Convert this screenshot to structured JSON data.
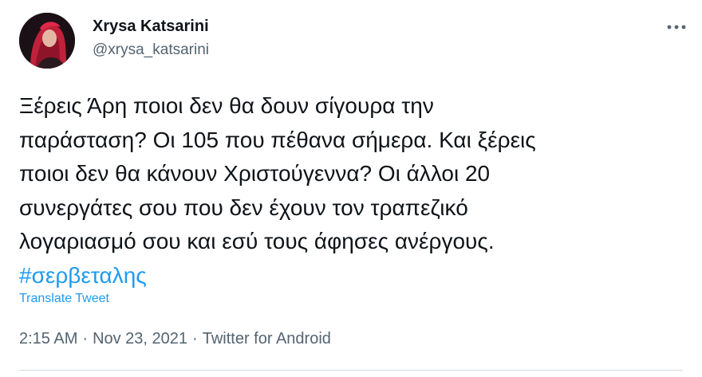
{
  "author": {
    "display_name": "Xrysa Katsarini",
    "handle": "@xrysa_katsarini"
  },
  "more_icon": "more-horizontal-icon",
  "tweet": {
    "text": "Ξέρεις Άρη ποιοι δεν θα δουν σίγουρα την\nπαράσταση? Οι 105 που πέθανα σήμερα. Και ξέρεις\nποιοι δεν θα κάνουν Χριστούγεννα? Οι άλλοι 20\nσυνεργάτες σου που δεν έχουν τον τραπεζικό\nλογαριασμό σου και εσύ τους άφησες ανέργους.\n",
    "hashtag": "#σερβεταλης",
    "translate_label": "Translate Tweet"
  },
  "meta": {
    "time": "2:15 AM",
    "separator": "·",
    "date": "Nov 23, 2021",
    "source": "Twitter for Android"
  },
  "colors": {
    "link": "#1d9bf0",
    "secondary_text": "#536471",
    "primary_text": "#0f1419",
    "divider": "#cfd9de"
  }
}
